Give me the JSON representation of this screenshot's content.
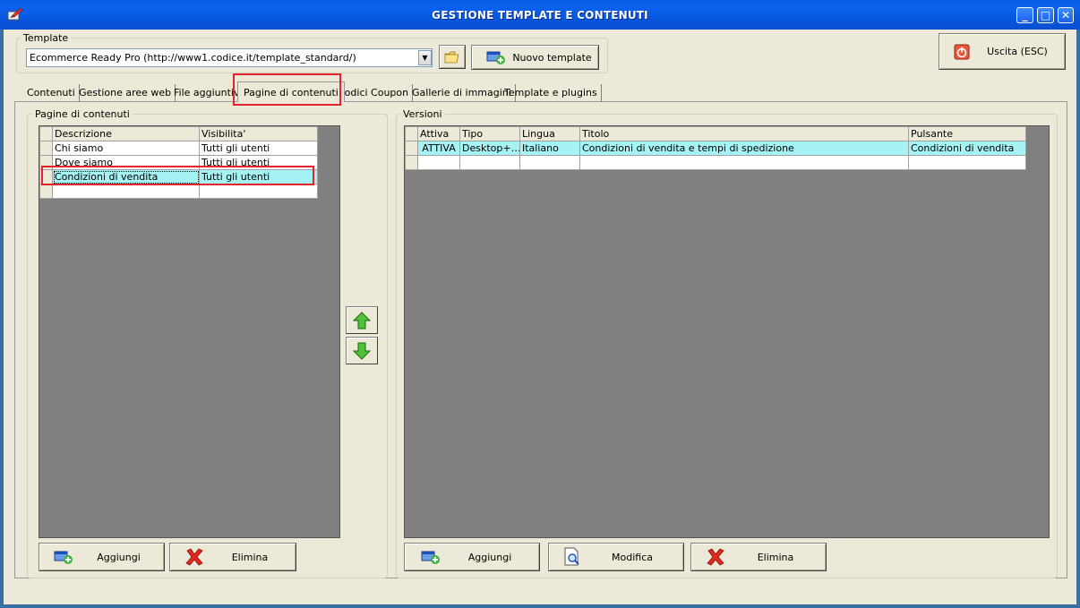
{
  "window": {
    "title": "GESTIONE TEMPLATE E CONTENUTI",
    "minimize": "_",
    "maximize": "□",
    "close": "✕"
  },
  "template_group": {
    "label": "Template",
    "combo_value": "Ecommerce Ready Pro (http://www1.codice.it/template_standard/)",
    "combo_arrow": "▼",
    "new_button": "Nuovo template"
  },
  "exit_button": "Uscita (ESC)",
  "tabs": [
    {
      "label": "Contenuti"
    },
    {
      "label": "Gestione aree web"
    },
    {
      "label": "File aggiuntivi"
    },
    {
      "label": "Pagine di contenuti"
    },
    {
      "label": "Codici Coupon"
    },
    {
      "label": "Gallerie di immagini"
    },
    {
      "label": "Template e plugins"
    }
  ],
  "pages": {
    "label": "Pagine di contenuti",
    "headers": [
      "Descrizione",
      "Visibilita'"
    ],
    "rows": [
      {
        "descrizione": "Chi siamo",
        "visibilita": "Tutti gli utenti"
      },
      {
        "descrizione": "Dove siamo",
        "visibilita": "Tutti gli utenti"
      },
      {
        "descrizione": "Condizioni di vendita",
        "visibilita": "Tutti gli utenti"
      }
    ],
    "add_button": "Aggiungi",
    "delete_button": "Elimina"
  },
  "versions": {
    "label": "Versioni",
    "headers": [
      "Attiva",
      "Tipo",
      "Lingua",
      "Titolo",
      "Pulsante"
    ],
    "rows": [
      {
        "attiva": "ATTIVA",
        "tipo": "Desktop+…",
        "lingua": "Italiano",
        "titolo": "Condizioni di vendita e tempi di spedizione",
        "pulsante": "Condizioni di vendita"
      }
    ],
    "add_button": "Aggiungi",
    "edit_button": "Modifica",
    "delete_button": "Elimina"
  },
  "colors": {
    "titlebar": "#0a5ae4",
    "selected_row": "#a6f3f5",
    "highlight": "#e1252a",
    "grid_background": "#808080"
  }
}
